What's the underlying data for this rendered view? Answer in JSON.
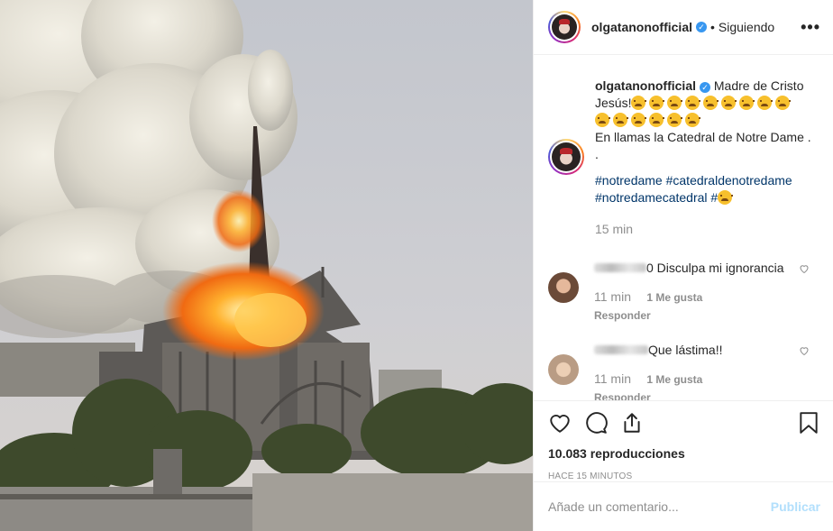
{
  "post": {
    "username": "olgatanonofficial",
    "verified_mark": "✓",
    "dot": "•",
    "follow_state": "Siguiendo",
    "more": "•••"
  },
  "caption": {
    "username": "olgatanonofficial",
    "text_1": "Madre de Cristo Jesús!",
    "emoji_name": "disappointed-relieved-emoji",
    "emoji_count_line1": 9,
    "emoji_count_line2": 6,
    "text_2": "En llamas la Catedral de Notre Dame .",
    "text_3": ".",
    "hashtags": [
      "#notredame",
      "#catedraldenotredame",
      "#notredamecatedral",
      "#"
    ],
    "time": "15 min"
  },
  "comments": [
    {
      "text": "0 Disculpa mi ignorancia",
      "time": "11 min",
      "likes": "1 Me gusta",
      "reply": "Responder"
    },
    {
      "text": "Que lástima!!",
      "time": "11 min",
      "likes": "1 Me gusta",
      "reply": "Responder"
    }
  ],
  "actions": {
    "views": "10.083 reproducciones",
    "ago": "HACE 15 MINUTOS",
    "icons": [
      "heart-icon",
      "comment-icon",
      "share-icon",
      "bookmark-icon"
    ]
  },
  "add_comment": {
    "placeholder": "Añade un comentario...",
    "publish": "Publicar"
  },
  "colors": {
    "link": "#003569",
    "muted": "#8e8e8e",
    "publish_disabled": "#b2dffc",
    "verified": "#3897f0"
  }
}
